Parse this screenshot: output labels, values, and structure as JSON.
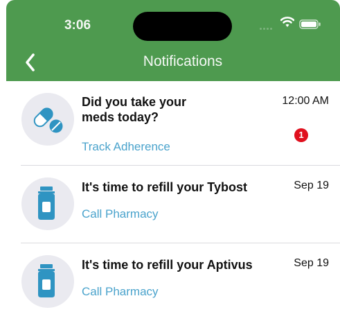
{
  "status_bar": {
    "time": "3:06",
    "icons": [
      "cellular-dots-icon",
      "wifi-icon",
      "battery-icon"
    ]
  },
  "nav": {
    "title": "Notifications",
    "back_icon": "chevron-left-icon"
  },
  "notifications": [
    {
      "icon": "pill-capsule-icon",
      "message": "Did you take your meds today?",
      "action": "Track Adherence",
      "time": "12:00 AM",
      "badge": "1"
    },
    {
      "icon": "medicine-bottle-icon",
      "message": "It's time to refill your Tybost",
      "action": "Call Pharmacy",
      "time": "Sep 19"
    },
    {
      "icon": "medicine-bottle-icon",
      "message": "It's time to refill your Aptivus",
      "action": "Call Pharmacy",
      "time": "Sep 19"
    }
  ],
  "colors": {
    "header_green": "#4e9a4f",
    "link_blue": "#4aa3cc",
    "icon_blue": "#2f94c2",
    "badge_red": "#e0101e"
  }
}
